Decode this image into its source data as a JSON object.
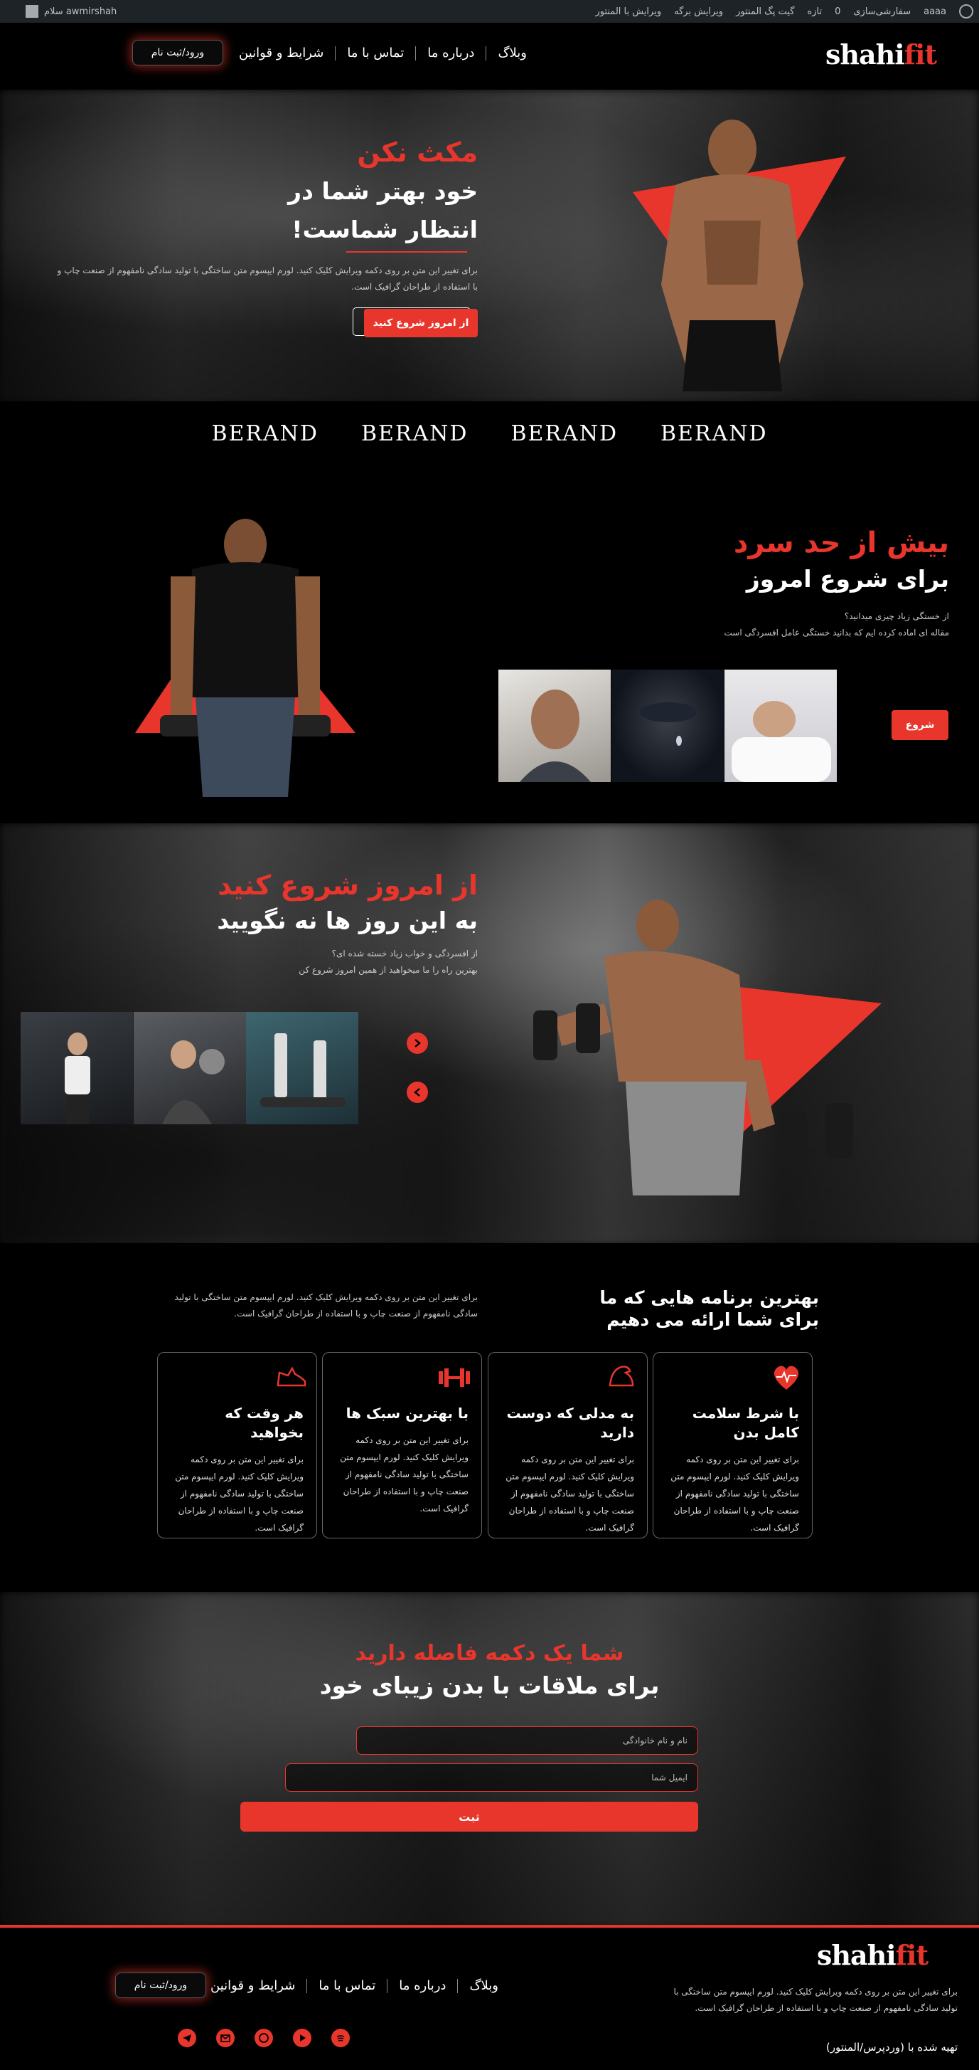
{
  "admin_bar": {
    "items": [
      "سفارشی‌سازی",
      "0",
      "تازه",
      "گیت پگ المنتور",
      "ویرایش برگه",
      "ویرایش با المنتور"
    ],
    "user_text": "سلام awmirshah",
    "site_text": "aaaa"
  },
  "header": {
    "logo_main": "shahi",
    "logo_accent": "fit",
    "nav": [
      "وبلاگ",
      "درباره ما",
      "تماس با ما",
      "شرایط و قوانین"
    ],
    "login": "ورود/ثبت نام"
  },
  "hero": {
    "title_red": "مکث نکن",
    "title_white": "خود بهتر شما در انتظار شماست!",
    "desc": "برای تغییر این متن بر روی دکمه ویرایش کلیک کنید. لورم ایپسوم متن ساختگی با تولید سادگی نامفهوم از صنعت چاپ و با استفاده از طراحان گرافیک است.",
    "cta": "از امروز شروع کنید"
  },
  "brands": [
    "BERAND",
    "BERAND",
    "BERAND",
    "BERAND"
  ],
  "section2": {
    "title_red": "بیش از حد سرد",
    "title_white": "برای شروع امروز",
    "desc_line1": "از خستگی زیاد چیزی میدانید؟",
    "desc_line2": "مقاله ای اماده کرده ایم که بدانید خستگی عامل افسردگی است",
    "button": "شروع"
  },
  "section3": {
    "title_red": "از امروز شروع کنید",
    "title_white": "به این روز ها نه نگویید",
    "desc_line1": "از افسردگی و خواب زیاد خسته شده ای؟",
    "desc_line2": "بهترین راه را ما میخواهید از همین امروز شروع کن"
  },
  "programs": {
    "title": "بهترین برنامه هایی که ما برای شما ارائه می دهیم",
    "intro": "برای تغییر این متن بر روی دکمه ویرایش کلیک کنید. لورم ایپسوم متن ساختگی با تولید سادگی نامفهوم از صنعت چاپ و با استفاده از طراحان گرافیک است.",
    "cards": [
      {
        "title": "با شرط سلامت کامل بدن",
        "text": "برای تغییر این متن بر روی دکمه ویرایش کلیک کنید. لورم ایپسوم متن ساختگی با تولید سادگی نامفهوم از صنعت چاپ و با استفاده از طراحان گرافیک است."
      },
      {
        "title": "به مدلی که دوست دارید",
        "text": "برای تغییر این متن بر روی دکمه ویرایش کلیک کنید. لورم ایپسوم متن ساختگی با تولید سادگی نامفهوم از صنعت چاپ و با استفاده از طراحان گرافیک است."
      },
      {
        "title": "با بهترین سبک ها",
        "text": "برای تغییر این متن بر روی دکمه ویرایش کلیک کنید. لورم ایپسوم متن ساختگی با تولید سادگی نامفهوم از صنعت چاپ و با استفاده از طراحان گرافیک است."
      },
      {
        "title": "هر وقت که بخواهید",
        "text": "برای تغییر این متن بر روی دکمه ویرایش کلیک کنید. لورم ایپسوم متن ساختگی با تولید سادگی نامفهوم از صنعت چاپ و با استفاده از طراحان گرافیک است."
      }
    ]
  },
  "contact": {
    "title_red": "شما یک دکمه فاصله دارید",
    "title_white": "برای ملاقات با بدن زیبای خود",
    "name_placeholder": "نام و نام خانوادگی",
    "email_placeholder": "ایمیل شما",
    "submit": "ثبت"
  },
  "footer": {
    "logo_main": "shahi",
    "logo_accent": "fit",
    "desc": "برای تغییر این متن بر روی دکمه ویرایش کلیک کنید. لورم ایپسوم متن ساختگی با تولید سادگی نامفهوم از صنعت چاپ و با استفاده از طراحان گرافیک است.",
    "nav": [
      "وبلاگ",
      "درباره ما",
      "تماس با ما",
      "شرایط و قوانین"
    ],
    "login": "ورود/ثبت نام",
    "credit": "تهیه شده با (وردپرس/المنتور)",
    "socials": [
      "spotify-icon",
      "youtube-icon",
      "whatsapp-icon",
      "email-icon",
      "telegram-icon"
    ]
  },
  "colors": {
    "accent": "#e8362d",
    "background": "#000000",
    "admin_bar": "#1d2327"
  }
}
